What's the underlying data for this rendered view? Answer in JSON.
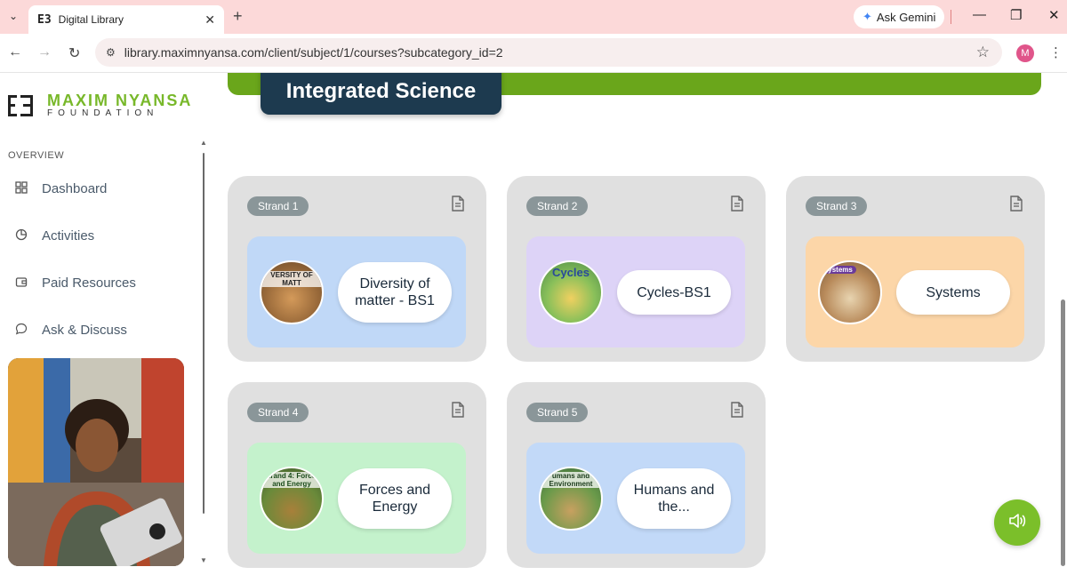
{
  "browser": {
    "tab_title": "Digital Library",
    "tab_favicon": "E3",
    "ask_gemini": "Ask Gemini",
    "url": "library.maximnyansa.com/client/subject/1/courses?subcategory_id=2",
    "profile_initial": "M"
  },
  "sidebar": {
    "brand_top": "MAXIM NYANSA",
    "brand_bottom": "FOUNDATION",
    "section": "OVERVIEW",
    "items": [
      {
        "label": "Dashboard",
        "icon": "grid-icon"
      },
      {
        "label": "Activities",
        "icon": "pie-chart-icon"
      },
      {
        "label": "Paid Resources",
        "icon": "wallet-icon"
      },
      {
        "label": "Ask & Discuss",
        "icon": "chat-bubble-icon"
      }
    ]
  },
  "main": {
    "subject_title": "Integrated Science",
    "strands": [
      {
        "badge": "Strand 1",
        "name": "Diversity of matter - BS1",
        "thumb_caption": "VERSITY OF MATT",
        "bg": "#c0d8f7"
      },
      {
        "badge": "Strand 2",
        "name": "Cycles-BS1",
        "thumb_caption": "Cycles",
        "bg": "#ddd3f7"
      },
      {
        "badge": "Strand 3",
        "name": "Systems",
        "thumb_caption": "Systems",
        "bg": "#fcd6a8"
      },
      {
        "badge": "Strand 4",
        "name": "Forces and Energy",
        "thumb_caption": "Strand 4: Forces and Energy",
        "bg": "#c4f2cc"
      },
      {
        "badge": "Strand 5",
        "name": "Humans and the...",
        "thumb_caption": "umans and Environment",
        "bg": "#c2d9f8"
      }
    ]
  },
  "colors": {
    "accent_green": "#6aa61b",
    "subject_pill": "#1d3a4f",
    "badge": "#8a9699"
  }
}
